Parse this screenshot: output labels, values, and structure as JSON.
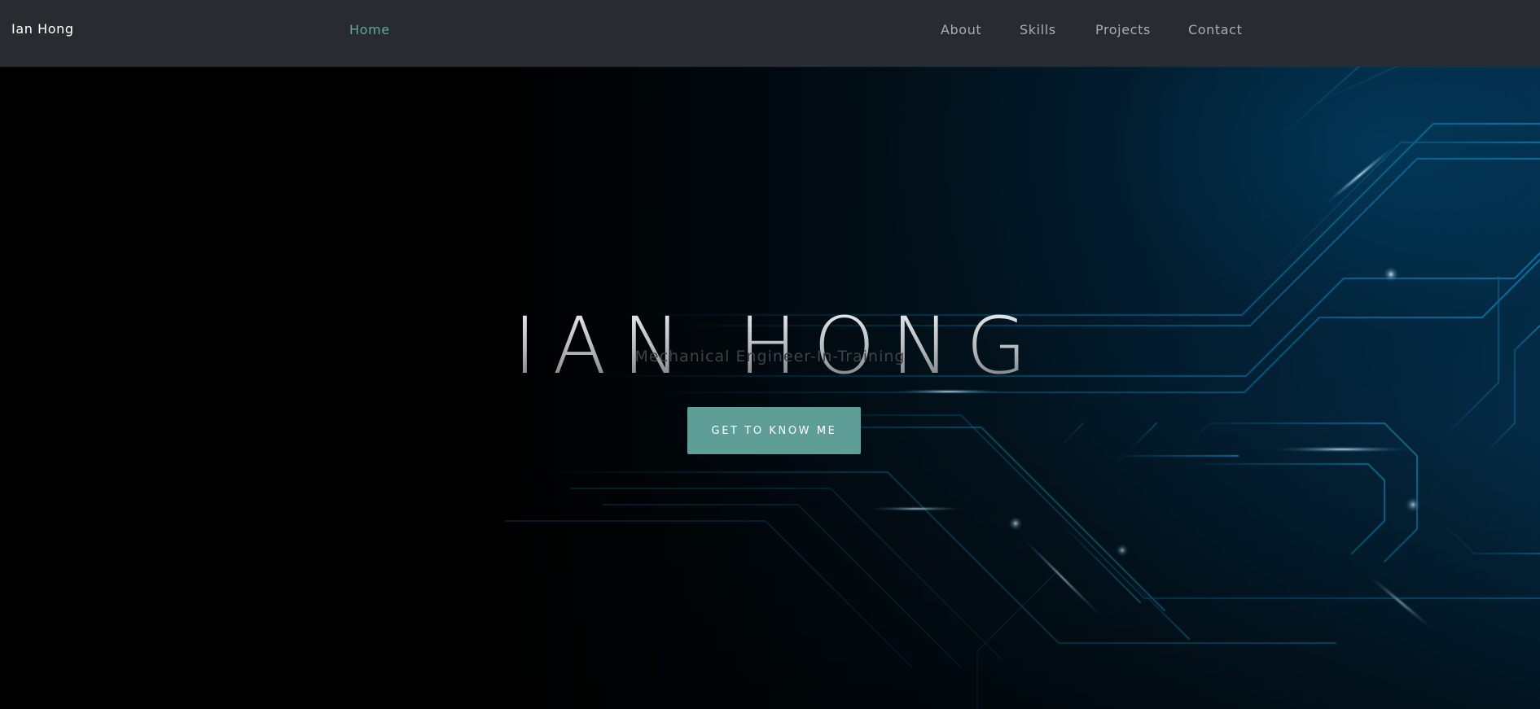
{
  "navbar": {
    "brand": "Ian Hong",
    "links": [
      {
        "label": "Home",
        "active": true
      },
      {
        "label": "About",
        "active": false
      },
      {
        "label": "Skills",
        "active": false
      },
      {
        "label": "Projects",
        "active": false
      },
      {
        "label": "Contact",
        "active": false
      }
    ]
  },
  "hero": {
    "title": "IAN HONG",
    "subtitle": "Mechanical Engineer-In-Training",
    "cta_label": "GET TO KNOW ME",
    "background_icon": "circuit-board-pattern"
  },
  "colors": {
    "navbar_bg": "#282c31",
    "accent": "#5fa8a0",
    "button_bg": "#5e9e97",
    "nav_text": "#a8adb3",
    "circuit_line": "#0f5f8a"
  }
}
